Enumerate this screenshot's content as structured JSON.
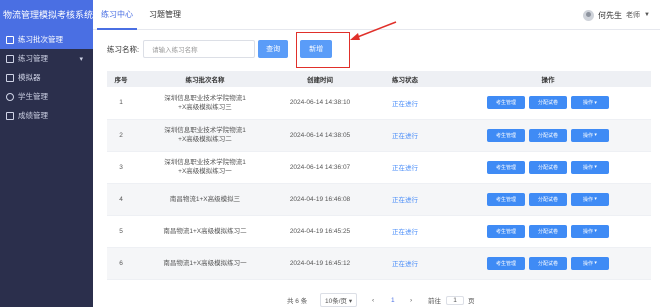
{
  "app": {
    "title": "物流管理模拟考核系统"
  },
  "sidebar": {
    "items": [
      {
        "label": "练习批次管理",
        "active": true
      },
      {
        "label": "练习管理",
        "expandable": true
      },
      {
        "label": "模拟器"
      },
      {
        "label": "学生管理"
      },
      {
        "label": "成绩管理"
      }
    ]
  },
  "header": {
    "tabs": [
      {
        "label": "练习中心"
      },
      {
        "label": "习题管理"
      }
    ],
    "user_name": "何先生",
    "user_role": "老师"
  },
  "toolbar": {
    "name_label": "练习名称:",
    "name_placeholder": "请输入练习名称",
    "search_label": "查询",
    "add_label": "新增"
  },
  "table": {
    "headers": {
      "index": "序号",
      "name": "练习批次名称",
      "created": "创建时间",
      "status": "练习状态",
      "ops": "操作"
    },
    "rows": [
      {
        "index": "1",
        "name1": "深圳信息职业技术学院物流1",
        "name2": "+X高级模拟练习三",
        "created": "2024-06-14 14:38:10",
        "status": "正在进行"
      },
      {
        "index": "2",
        "name1": "深圳信息职业技术学院物流1",
        "name2": "+X高级模拟练习二",
        "created": "2024-06-14 14:38:05",
        "status": "正在进行"
      },
      {
        "index": "3",
        "name1": "深圳信息职业技术学院物流1",
        "name2": "+X高级模拟练习一",
        "created": "2024-06-14 14:36:07",
        "status": "正在进行"
      },
      {
        "index": "4",
        "name1": "南昌物流1+X高级模拟三",
        "name2": "",
        "created": "2024-04-19 16:46:08",
        "status": "正在进行"
      },
      {
        "index": "5",
        "name1": "南昌物流1+X高级模拟练习二",
        "name2": "",
        "created": "2024-04-19 16:45:25",
        "status": "正在进行"
      },
      {
        "index": "6",
        "name1": "南昌物流1+X高级模拟练习一",
        "name2": "",
        "created": "2024-04-19 16:45:12",
        "status": "正在进行"
      }
    ],
    "ops": {
      "student_mgmt": "考生管理",
      "assign_paper": "分配试卷",
      "actions": "操作"
    }
  },
  "pagination": {
    "total": "共 6 条",
    "page_size": "10条/页",
    "current": "1",
    "goto_label": "前往",
    "goto_value": "1",
    "page_unit": "页"
  },
  "colors": {
    "accent": "#4a6fe3",
    "sidebar": "#2b2f4c",
    "button": "#5a9cf8",
    "highlight": "#e0302a"
  }
}
